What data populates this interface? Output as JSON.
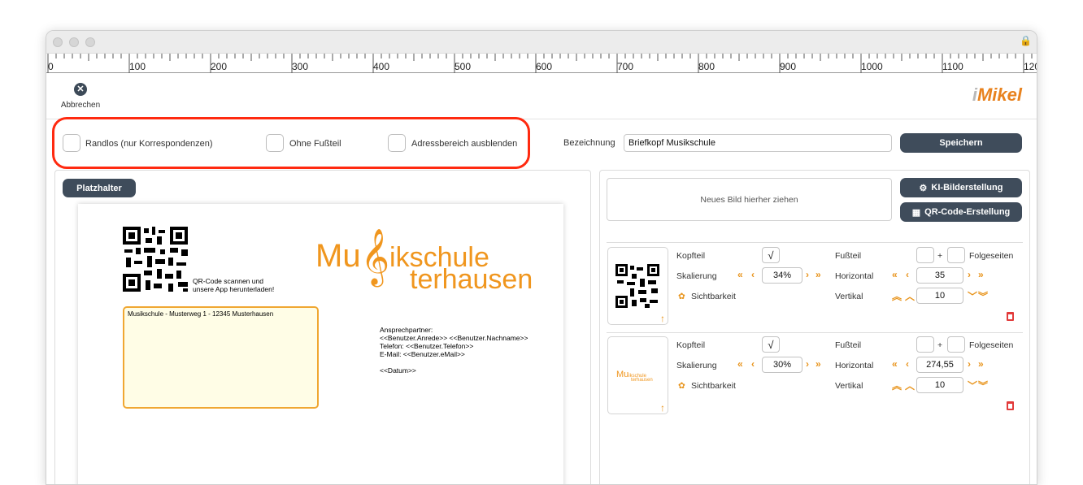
{
  "toolbar": {
    "cancel_label": "Abbrechen",
    "logo_text": "Mikel",
    "logo_prefix": "i"
  },
  "ruler": {
    "ticks": [
      "0",
      "100",
      "200",
      "300",
      "400",
      "500",
      "600",
      "700",
      "800",
      "900",
      "1000",
      "1100",
      "1200"
    ]
  },
  "options": {
    "borderless_label": "Randlos (nur Korrespondenzen)",
    "no_footer_label": "Ohne Fußteil",
    "hide_address_label": "Adressbereich ausblenden"
  },
  "designation": {
    "label": "Bezeichnung",
    "value": "Briefkopf Musikschule",
    "save_label": "Speichern"
  },
  "placeholder_button": "Platzhalter",
  "letter": {
    "qr_caption_1": "QR-Code scannen und",
    "qr_caption_2": "unsere App herunterladen!",
    "logo_line1_a": "Mu",
    "logo_line1_b": "ikschule",
    "logo_line2": "terhausen",
    "sender_line": "Musikschule - Musterweg 1 - 12345 Musterhausen",
    "contact_1": "Ansprechpartner:",
    "contact_2": "<<Benutzer.Anrede>> <<Benutzer.Nachname>>",
    "contact_3": "Telefon: <<Benutzer.Telefon>>",
    "contact_4": "E-Mail: <<Benutzer.eMail>>",
    "date": "<<Datum>>"
  },
  "images": {
    "drop_label": "Neues Bild hierher ziehen",
    "ai_button": "KI-Bilderstellung",
    "qr_button": "QR-Code-Erstellung",
    "labels": {
      "header": "Kopfteil",
      "footer": "Fußteil",
      "plus": "+",
      "following": "Folgeseiten",
      "scale": "Skalierung",
      "horizontal": "Horizontal",
      "visibility": "Sichtbarkeit",
      "vertical": "Vertikal"
    },
    "items": [
      {
        "header_checked": "√",
        "scale": "34%",
        "horizontal": "35",
        "vertical": "10"
      },
      {
        "header_checked": "√",
        "scale": "30%",
        "horizontal": "274,55",
        "vertical": "10"
      }
    ],
    "thumb_logo_a": "Mu",
    "thumb_logo_b": "ikschule",
    "thumb_logo_c": "terhausen"
  },
  "colors": {
    "accent": "#f0961e",
    "button": "#3f4c5b",
    "highlight": "#ff2a10"
  }
}
